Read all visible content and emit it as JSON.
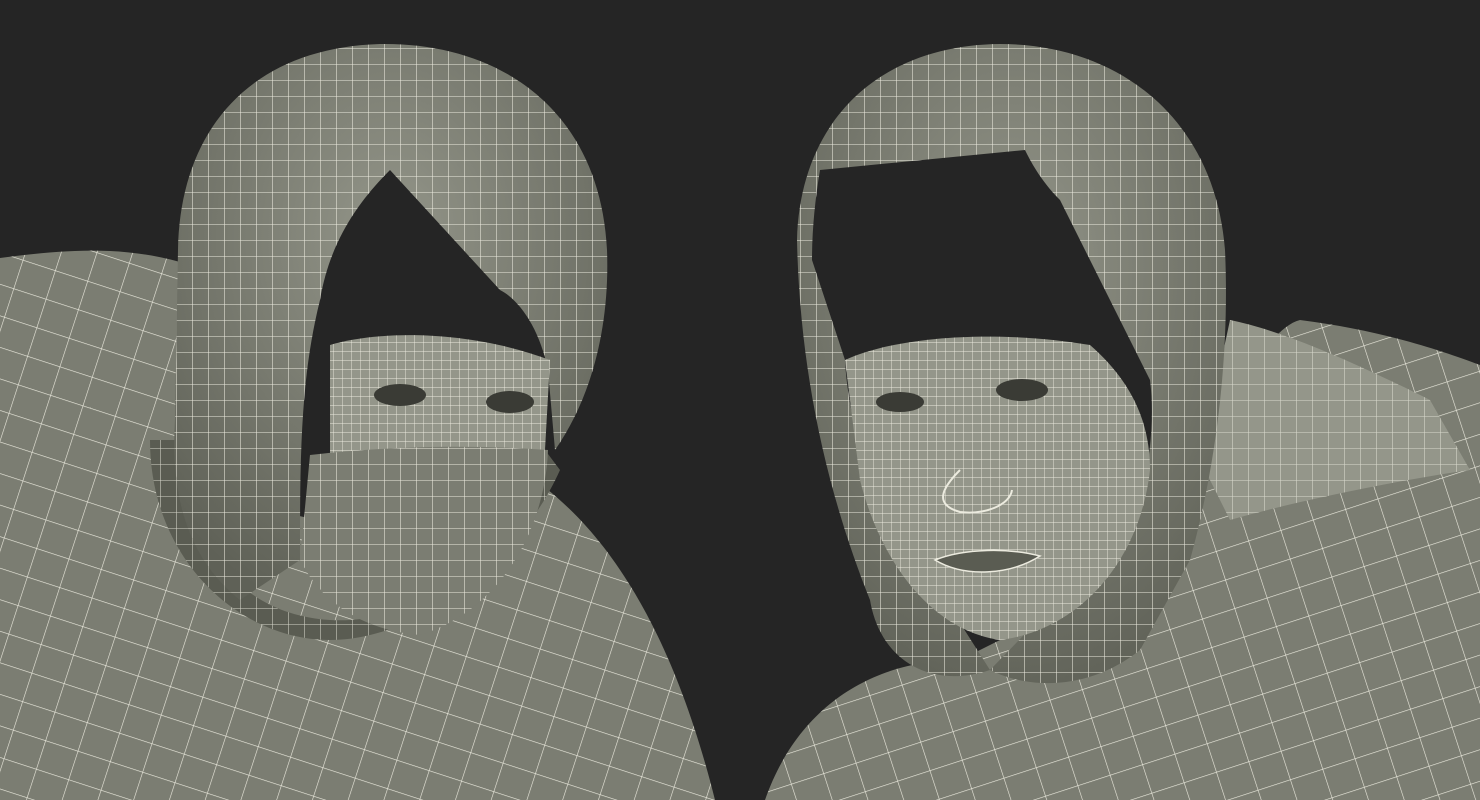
{
  "scene": {
    "background_color": "#252525",
    "surface_color": "#7b7d72",
    "surface_shadow_color": "#5a5c52",
    "surface_highlight_color": "#94968a",
    "wire_color": "#ecebdf",
    "figures": [
      {
        "name": "masked-figure",
        "face_covered": true
      },
      {
        "name": "open-face-figure",
        "face_covered": false
      }
    ]
  }
}
